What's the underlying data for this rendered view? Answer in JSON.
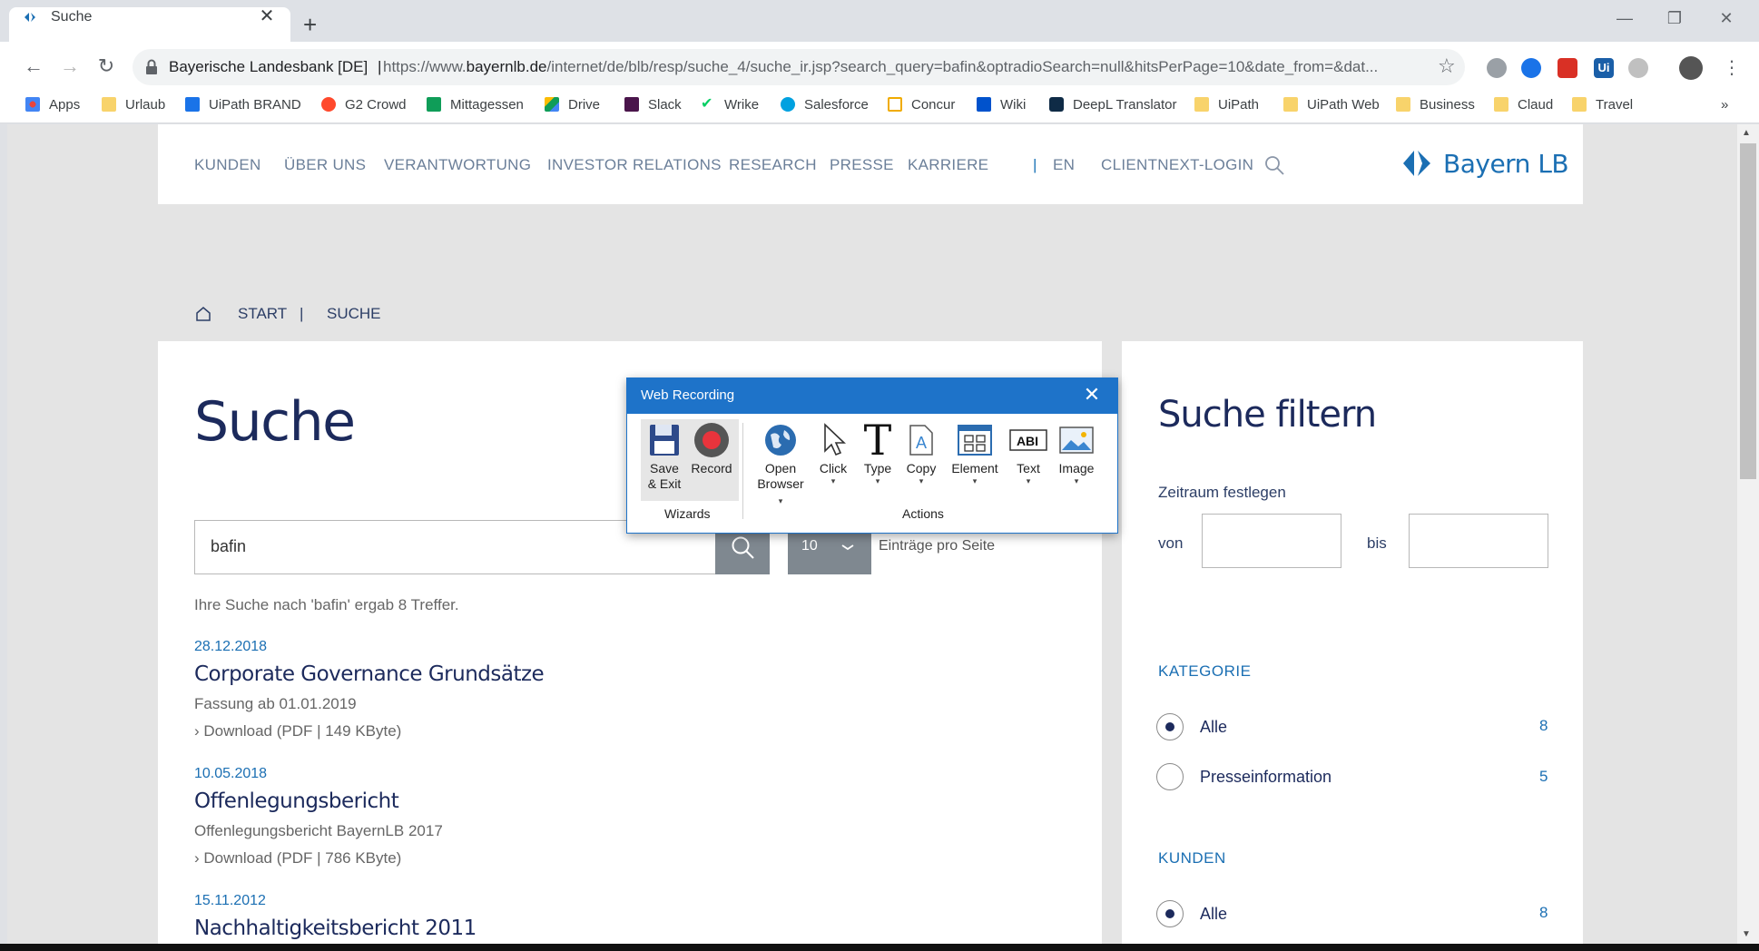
{
  "browser": {
    "tab_title": "Suche",
    "tab_close": "✕",
    "new_tab": "+",
    "window_controls": [
      "—",
      "❐",
      "✕"
    ],
    "site_name": "Bayerische Landesbank [DE]",
    "separator": "|",
    "url_prefix": "https://www.",
    "url_domain": "bayernlb.de",
    "url_path": "/internet/de/blb/resp/suche_4/suche_ir.jsp?search_query=bafin&optradioSearch=null&hitsPerPage=10&date_from=&dat...",
    "bookmarks": [
      {
        "label": "Apps",
        "icon": "apps-grid-icon",
        "color": "#e8453c"
      },
      {
        "label": "Urlaub",
        "icon": "folder-icon",
        "color": "#f8d36b"
      },
      {
        "label": "UiPath BRAND",
        "icon": "uipath-v-icon",
        "color": "#1a73e8"
      },
      {
        "label": "G2 Crowd",
        "icon": "g2-icon",
        "color": "#ff492c"
      },
      {
        "label": "Mittagessen",
        "icon": "plus-sheet-icon",
        "color": "#0f9d58"
      },
      {
        "label": "Drive",
        "icon": "drive-icon",
        "color": "#fbbc04"
      },
      {
        "label": "Slack",
        "icon": "slack-icon",
        "color": "#4a154b"
      },
      {
        "label": "Wrike",
        "icon": "check-icon",
        "color": "#08cf65"
      },
      {
        "label": "Salesforce",
        "icon": "cloud-icon",
        "color": "#00a1e0"
      },
      {
        "label": "Concur",
        "icon": "concur-icon",
        "color": "#f0ab00"
      },
      {
        "label": "Wiki",
        "icon": "confluence-icon",
        "color": "#0052cc"
      },
      {
        "label": "DeepL Translator",
        "icon": "deepl-icon",
        "color": "#0f2b46"
      },
      {
        "label": "UiPath",
        "icon": "folder-icon",
        "color": "#f8d36b"
      },
      {
        "label": "UiPath Web",
        "icon": "folder-icon",
        "color": "#f8d36b"
      },
      {
        "label": "Business",
        "icon": "folder-icon",
        "color": "#f8d36b"
      },
      {
        "label": "Claud",
        "icon": "folder-icon",
        "color": "#f8d36b"
      },
      {
        "label": "Travel",
        "icon": "folder-icon",
        "color": "#f8d36b"
      }
    ],
    "bookmarks_overflow": "»"
  },
  "site": {
    "nav": [
      "KUNDEN",
      "ÜBER UNS",
      "VERANTWORTUNG",
      "INVESTOR RELATIONS",
      "RESEARCH",
      "PRESSE",
      "KARRIERE"
    ],
    "nav_sep": "|",
    "lang": "EN",
    "login": "CLIENTNEXT-LOGIN",
    "logo_text": "Bayern LB",
    "brand_color": "#1b6fb3",
    "breadcrumb": [
      "START",
      "SUCHE"
    ],
    "breadcrumb_sep": "|",
    "page_title": "Suche",
    "search_value": "bafin",
    "per_page_value": "10",
    "per_page_label": "Einträge pro Seite",
    "result_summary": "Ihre Suche nach 'bafin' ergab 8 Treffer.",
    "results": [
      {
        "date": "28.12.2018",
        "title": "Corporate Governance Grundsätze",
        "subtitle": "Fassung ab 01.01.2019",
        "download": "› Download (PDF | 149 KByte)"
      },
      {
        "date": "10.05.2018",
        "title": "Offenlegungsbericht",
        "subtitle": "Offenlegungsbericht BayernLB 2017",
        "download": "› Download (PDF | 786 KByte)"
      },
      {
        "date": "15.11.2012",
        "title": "Nachhaltigkeitsbericht 2011",
        "subtitle": "",
        "download": ""
      }
    ],
    "filter": {
      "title": "Suche filtern",
      "timeframe_label": "Zeitraum festlegen",
      "from_label": "von",
      "to_label": "bis",
      "from_value": "",
      "to_value": "",
      "kategorie_heading": "KATEGORIE",
      "kategorie_options": [
        {
          "label": "Alle",
          "count": "8",
          "selected": true
        },
        {
          "label": "Presseinformation",
          "count": "5",
          "selected": false
        }
      ],
      "kunden_heading": "KUNDEN",
      "kunden_options": [
        {
          "label": "Alle",
          "count": "8",
          "selected": true
        }
      ]
    }
  },
  "recorder": {
    "title": "Web Recording",
    "close": "✕",
    "wizards_label": "Wizards",
    "actions_label": "Actions",
    "save_exit": [
      "Save",
      "& Exit"
    ],
    "record": "Record",
    "open_browser": [
      "Open",
      "Browser"
    ],
    "click": "Click",
    "type": "Type",
    "copy": "Copy",
    "element": "Element",
    "text": "Text",
    "image": "Image",
    "caret": "▾",
    "accent_color": "#1e73c9"
  }
}
